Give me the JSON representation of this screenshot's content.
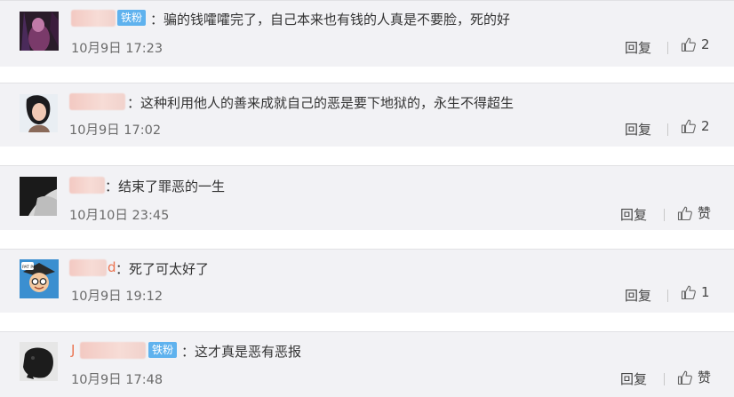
{
  "comments": [
    {
      "badge": "铁粉",
      "text": "：骗的钱嚯嚯完了，自己本来也有钱的人真是不要脸，死的好",
      "time": "10月9日 17:23",
      "reply": "回复",
      "likes": "2"
    },
    {
      "badge": "",
      "text": "：这种利用他人的善来成就自己的恶是要下地狱的，永生不得超生",
      "time": "10月9日 17:02",
      "reply": "回复",
      "likes": "2"
    },
    {
      "badge": "",
      "text": "：结束了罪恶的一生",
      "time": "10月10日 23:45",
      "reply": "回复",
      "likes": "赞"
    },
    {
      "badge": "",
      "name_visible": "d",
      "avatar_text": "PAT PAT",
      "text": "：死了可太好了",
      "time": "10月9日 19:12",
      "reply": "回复",
      "likes": "1"
    },
    {
      "badge": "铁粉",
      "name_visible": "J",
      "text": "：这才真是恶有恶报",
      "time": "10月9日 17:48",
      "reply": "回复",
      "likes": "赞"
    }
  ],
  "colors": {
    "card_bg": "#f2f2f5",
    "badge_bg": "#5fb2ee",
    "text": "#333333",
    "time": "#6b6b6b"
  },
  "icons": {
    "like": "thumbs-up-icon"
  }
}
